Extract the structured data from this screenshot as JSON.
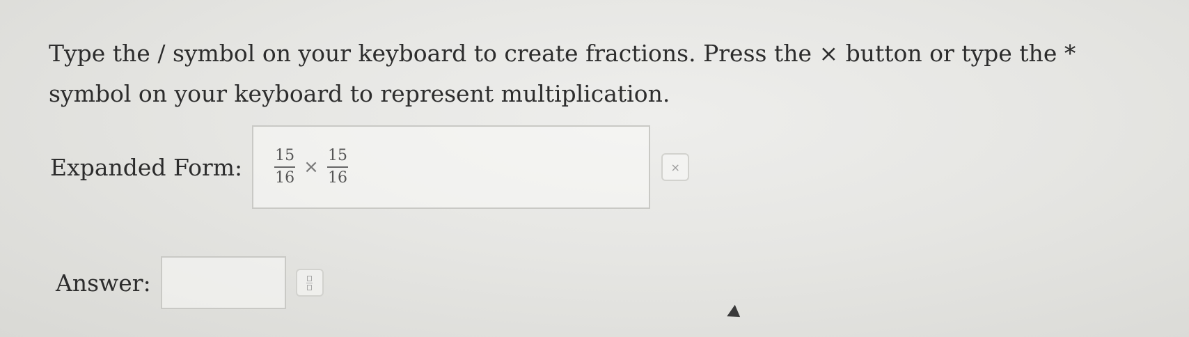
{
  "instructions": {
    "text": "Type the / symbol on your keyboard to create fractions. Press the × button or type the * symbol on your keyboard to represent multiplication."
  },
  "expanded": {
    "label": "Expanded Form:",
    "fraction1": {
      "numerator": "15",
      "denominator": "16"
    },
    "operator": "×",
    "fraction2": {
      "numerator": "15",
      "denominator": "16"
    },
    "times_button_label": "×"
  },
  "answer": {
    "label": "Answer:",
    "value": ""
  },
  "icons": {
    "times_button": "times-icon",
    "fraction_button": "fraction-icon",
    "cursor": "mouse-pointer-icon"
  }
}
